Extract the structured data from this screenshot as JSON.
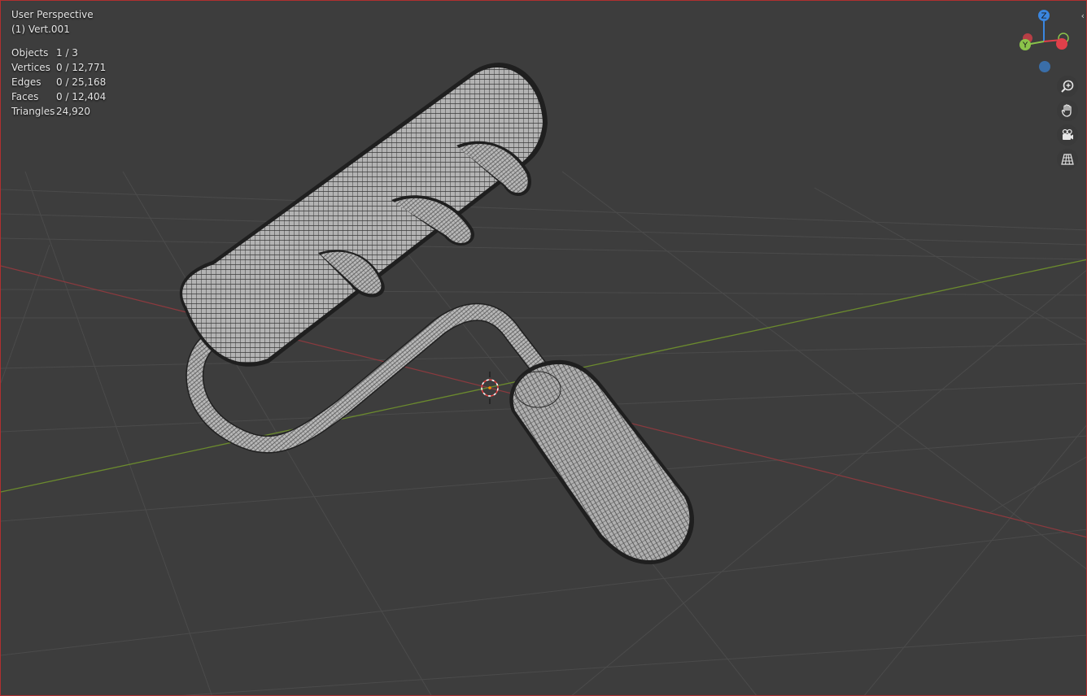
{
  "viewport": {
    "view_name": "User Perspective",
    "active_object": "(1) Vert.001",
    "stats": [
      {
        "label": "Objects",
        "value": "1 / 3"
      },
      {
        "label": "Vertices",
        "value": "0 / 12,771"
      },
      {
        "label": "Edges",
        "value": "0 / 25,168"
      },
      {
        "label": "Faces",
        "value": "0 / 12,404"
      },
      {
        "label": "Triangles",
        "value": "24,920"
      }
    ]
  },
  "gizmo": {
    "z_label": "Z",
    "y_label": "Y",
    "colors": {
      "x": "#e0404a",
      "y": "#8bc34a",
      "z": "#3a86e0"
    }
  },
  "nav_tools": [
    {
      "name": "zoom",
      "icon": "magnifier-plus-icon"
    },
    {
      "name": "pan",
      "icon": "hand-icon"
    },
    {
      "name": "camera-view",
      "icon": "camera-icon"
    },
    {
      "name": "perspective-toggle",
      "icon": "grid-perspective-icon"
    }
  ],
  "colors": {
    "background": "#3d3d3d",
    "grid": "#4d4d4d",
    "x_axis": "#8b3a3e",
    "y_axis": "#6b8a2e",
    "mesh_fill": "#b0b0b0",
    "mesh_wire": "#2a2a2a"
  }
}
